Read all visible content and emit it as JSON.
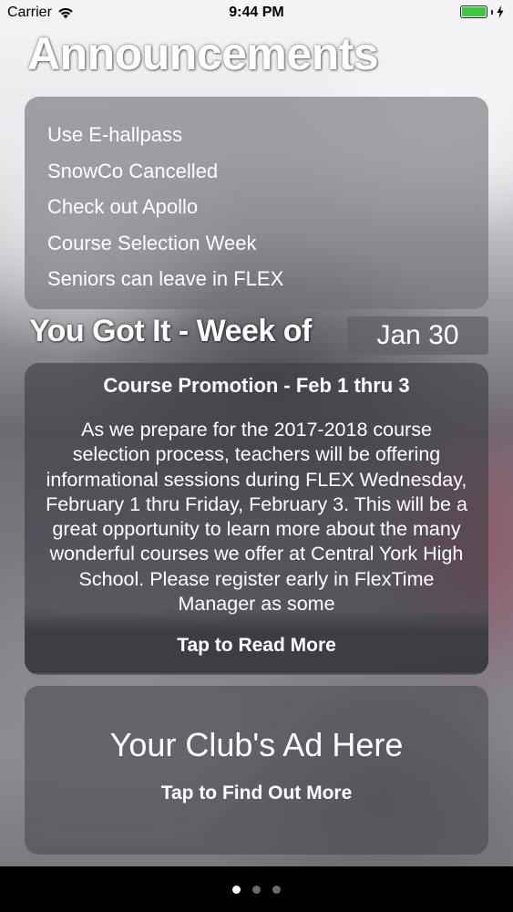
{
  "status_bar": {
    "carrier": "Carrier",
    "time": "9:44 PM",
    "battery_level": 1.0,
    "battery_color": "#3cc641"
  },
  "title": "Announcements",
  "announcements": [
    "Use E-hallpass",
    "SnowCo Cancelled",
    "Check out Apollo",
    "Course Selection Week",
    "Seniors can leave in FLEX"
  ],
  "section": {
    "heading": "You Got It - Week of",
    "week": "Jan 30"
  },
  "promo": {
    "title": "Course Promotion - Feb 1 thru 3",
    "body": "As we prepare for the 2017-2018 course selection process, teachers will be offering informational sessions during FLEX Wednesday, February 1 thru Friday, February 3.  This will be a great opportunity to learn more about the many wonderful courses we offer at Central York High School.  Please register early in FlexTime Manager as some",
    "more_label": "Tap to Read More"
  },
  "ad": {
    "title": "Your Club's Ad Here",
    "more_label": "Tap to Find Out More"
  },
  "page_control": {
    "total": 3,
    "current": 1
  }
}
